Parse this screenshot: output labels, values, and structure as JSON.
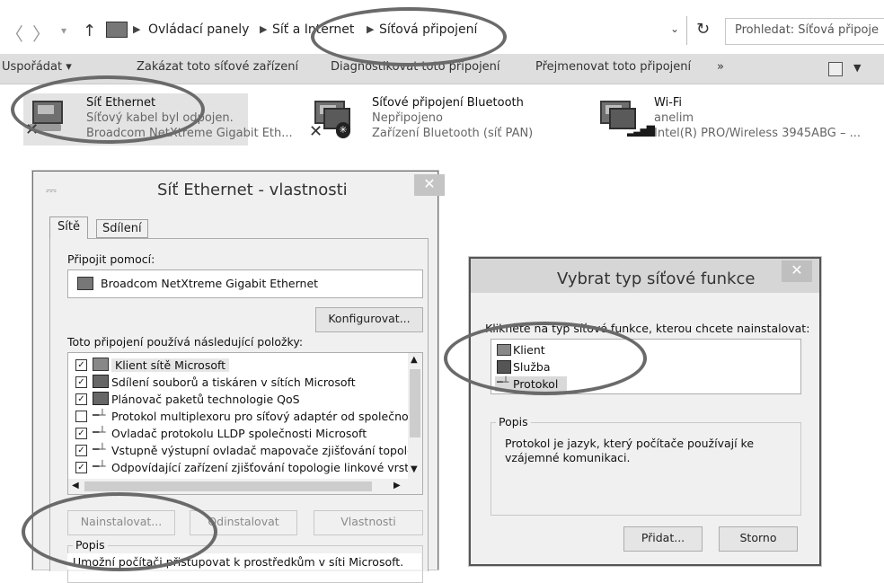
{
  "address": {
    "crumbs": [
      "Ovládací panely",
      "Síť a Internet",
      "Síťová připojení"
    ],
    "search_placeholder": "Prohledat: Síťová připoje"
  },
  "toolbar": {
    "items": [
      "Uspořádat ▾",
      "Zakázat toto síťové zařízení",
      "Diagnostikovat toto připojení",
      "Přejmenovat toto připojení",
      "»"
    ]
  },
  "connections": [
    {
      "name": "Síť Ethernet",
      "status": "Síťový kabel byl odpojen.",
      "device": "Broadcom NetXtreme Gigabit Eth..."
    },
    {
      "name": "Síťové připojení Bluetooth",
      "status": "Nepřipojeno",
      "device": "Zařízení Bluetooth (síť PAN)"
    },
    {
      "name": "Wi-Fi",
      "status": "anelim",
      "device": "Intel(R) PRO/Wireless 3945ABG – ..."
    }
  ],
  "props_dialog": {
    "title": "Síť Ethernet - vlastnosti",
    "tabs": [
      "Sítě",
      "Sdílení"
    ],
    "connect_using_label": "Připojit pomocí:",
    "adapter": "Broadcom NetXtreme Gigabit Ethernet",
    "configure_button": "Konfigurovat...",
    "items_label": "Toto připojení používá následující položky:",
    "items": [
      {
        "label": "Klient sítě Microsoft",
        "checked": true
      },
      {
        "label": "Sdílení souborů a tiskáren v sítích Microsoft",
        "checked": true
      },
      {
        "label": "Plánovač paketů technologie QoS",
        "checked": true
      },
      {
        "label": "Protokol multiplexoru pro síťový adaptér od společnosti",
        "checked": false
      },
      {
        "label": "Ovladač protokolu LLDP společnosti Microsoft",
        "checked": true
      },
      {
        "label": "Vstupně výstupní ovladač mapovače zjišťování topolo",
        "checked": true
      },
      {
        "label": "Odpovídající zařízení zjišťování topologie linkové vrst",
        "checked": true
      }
    ],
    "install_button": "Nainstalovat...",
    "uninstall_button": "Odinstalovat",
    "properties_button": "Vlastnosti",
    "description_label": "Popis",
    "description_text": "Umožní počítači přistupovat k prostředkům v síti Microsoft."
  },
  "type_dialog": {
    "title": "Vybrat typ síťové funkce",
    "instruction": "Klikněte na typ síťové funkce, kterou chcete nainstalovat:",
    "options": [
      "Klient",
      "Služba",
      "Protokol"
    ],
    "description_label": "Popis",
    "description_text": "Protokol je jazyk, který počítače používají ke vzájemné komunikaci.",
    "add_button": "Přidat...",
    "cancel_button": "Storno"
  }
}
